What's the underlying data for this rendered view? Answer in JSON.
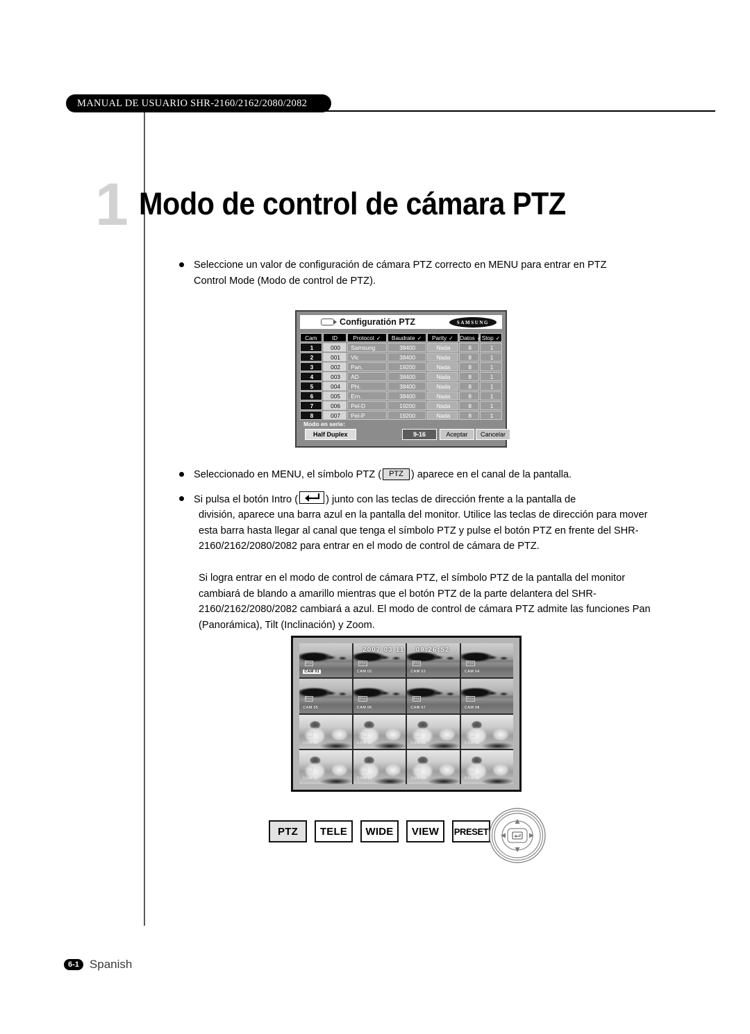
{
  "header": {
    "banner_text": "MANUAL DE USUARIO SHR-2160/2162/2080/2082"
  },
  "chapter": {
    "number": "1",
    "title": "Modo de control de cámara PTZ"
  },
  "bullets": {
    "b1_line1": "Seleccione un valor de configuración de cámara PTZ correcto en MENU para entrar en",
    "b1_line2": "PTZ Control Mode (Modo de control de PTZ).",
    "b2_pre": "Seleccionado en MENU, el símbolo PTZ (",
    "b2_badge": "PTZ",
    "b2_post": ") aparece en el canal de la pantalla.",
    "b3_pre": "Si pulsa el botón Intro (",
    "b3_post": ") junto con las teclas de dirección frente a la pantalla de"
  },
  "paragraphs": {
    "p1": "división, aparece una barra azul en la pantalla del monitor. Utilice las teclas de dirección para mover esta barra hasta llegar al canal que tenga el símbolo PTZ y pulse el botón PTZ en frente del SHR- 2160/2162/2080/2082 para entrar en el modo de control de cámara de PTZ.",
    "p2": "Si logra entrar en el modo de control de cámara PTZ, el símbolo PTZ de la pantalla del monitor cambiará de blando a amarillo mientras que el botón PTZ de la parte delantera del SHR-2160/2162/2080/2082 cambiará a azul. El modo de control de cámara PTZ admite las funciones Pan (Panorámica), Tilt (Inclinación) y Zoom."
  },
  "ptz_dialog": {
    "title": "Configuratión PTZ",
    "brand": "SAMSUNG",
    "columns": [
      "Cam",
      "ID",
      "Protocol",
      "Baudrate",
      "Parity",
      "Datos",
      "Stop"
    ],
    "column_checkmarks": [
      false,
      false,
      true,
      true,
      true,
      true,
      true
    ],
    "rows": [
      {
        "cam": "1",
        "id": "000",
        "protocol": "Samsung",
        "baudrate": "38400",
        "parity": "Nada",
        "datos": "8",
        "stop": "1"
      },
      {
        "cam": "2",
        "id": "001",
        "protocol": "Vic",
        "baudrate": "38400",
        "parity": "Nada",
        "datos": "8",
        "stop": "1"
      },
      {
        "cam": "3",
        "id": "002",
        "protocol": "Pan.",
        "baudrate": "19200",
        "parity": "Nada",
        "datos": "8",
        "stop": "1"
      },
      {
        "cam": "4",
        "id": "003",
        "protocol": "AD",
        "baudrate": "38400",
        "parity": "Nada",
        "datos": "8",
        "stop": "1"
      },
      {
        "cam": "5",
        "id": "004",
        "protocol": "Phi.",
        "baudrate": "38400",
        "parity": "Nada",
        "datos": "8",
        "stop": "1"
      },
      {
        "cam": "6",
        "id": "005",
        "protocol": "Ern.",
        "baudrate": "38400",
        "parity": "Nada",
        "datos": "8",
        "stop": "1"
      },
      {
        "cam": "7",
        "id": "006",
        "protocol": "Pel-D",
        "baudrate": "19200",
        "parity": "Nada",
        "datos": "8",
        "stop": "1"
      },
      {
        "cam": "8",
        "id": "007",
        "protocol": "Pel-P",
        "baudrate": "19200",
        "parity": "Nada",
        "datos": "8",
        "stop": "1"
      }
    ],
    "serial_mode_label": "Modo en serie:",
    "serial_mode_value": "Half Duplex",
    "button_range": "9-16",
    "button_accept": "Aceptar",
    "button_cancel": "Cancelar"
  },
  "monitor": {
    "date": "2007 03 11",
    "time": "09:26:52",
    "osd_badge": "PTZ",
    "channels": [
      {
        "label": "CAM 01",
        "selected": true,
        "faint": false
      },
      {
        "label": "CAM 02",
        "selected": false,
        "faint": false
      },
      {
        "label": "CAM 03",
        "selected": false,
        "faint": false
      },
      {
        "label": "CAM 04",
        "selected": false,
        "faint": false
      },
      {
        "label": "CAM 05",
        "selected": false,
        "faint": false
      },
      {
        "label": "CAM 06",
        "selected": false,
        "faint": false
      },
      {
        "label": "CAM 07",
        "selected": false,
        "faint": false
      },
      {
        "label": "CAM 08",
        "selected": false,
        "faint": false
      },
      {
        "label": "CAM 09",
        "selected": false,
        "faint": true
      },
      {
        "label": "CAM 10",
        "selected": false,
        "faint": true
      },
      {
        "label": "CAM 11",
        "selected": false,
        "faint": true
      },
      {
        "label": "CAM 12",
        "selected": false,
        "faint": true
      },
      {
        "label": "CAM 13",
        "selected": false,
        "faint": true
      },
      {
        "label": "CAM 14",
        "selected": false,
        "faint": true
      },
      {
        "label": "CAM 15",
        "selected": false,
        "faint": true
      },
      {
        "label": "CAM 16",
        "selected": false,
        "faint": true
      }
    ]
  },
  "controls": {
    "buttons": [
      {
        "label": "PTZ",
        "active": true
      },
      {
        "label": "TELE",
        "active": false
      },
      {
        "label": "WIDE",
        "active": false
      },
      {
        "label": "VIEW",
        "active": false
      },
      {
        "label": "PRESET",
        "active": false
      }
    ]
  },
  "footer": {
    "page": "6-1",
    "language": "Spanish"
  }
}
